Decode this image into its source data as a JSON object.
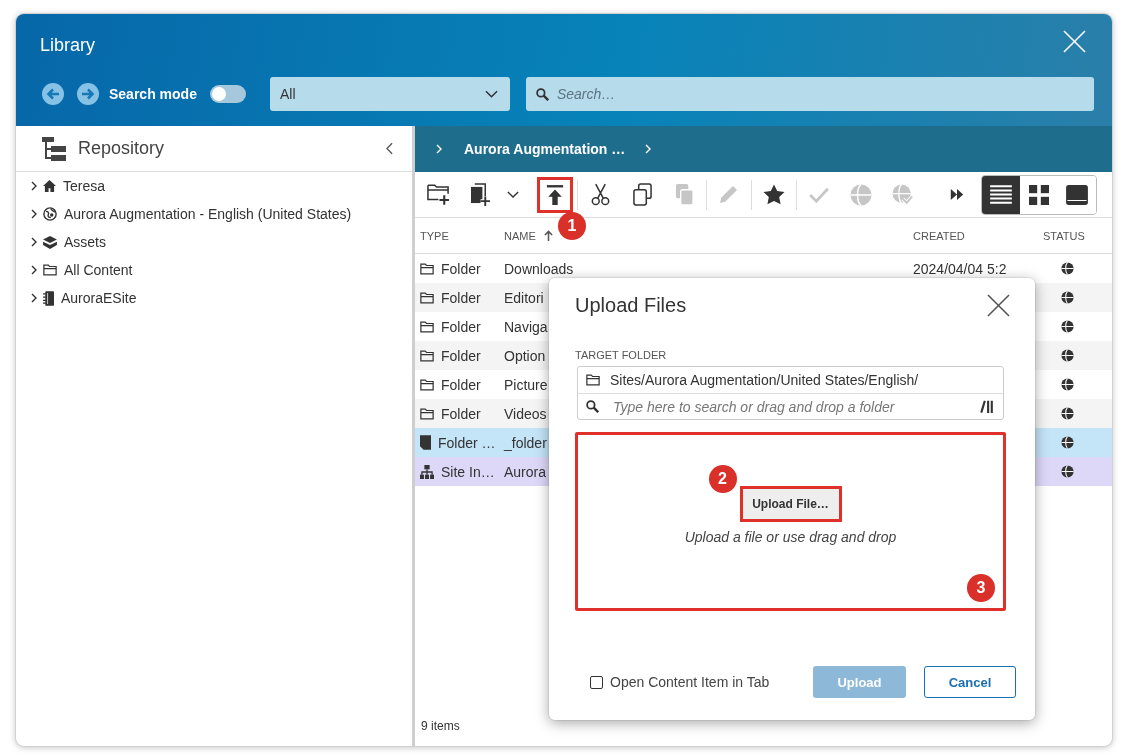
{
  "window": {
    "title": "Library"
  },
  "header": {
    "search_mode": {
      "label": "Search mode",
      "on": false
    },
    "filter": {
      "value": "All"
    },
    "search": {
      "placeholder": "Search…"
    }
  },
  "sidebar": {
    "title": "Repository",
    "items": [
      {
        "label": "Teresa",
        "expanded": false
      },
      {
        "label": "Aurora Augmentation - English (United States)",
        "expanded": false
      },
      {
        "label": "Assets",
        "expanded": false
      },
      {
        "label": "All Content",
        "expanded": false
      },
      {
        "label": "AuroraESite",
        "expanded": false
      }
    ]
  },
  "breadcrumb": {
    "items": [
      {
        "label": "Aurora Augmentation …"
      }
    ]
  },
  "toolbar": {
    "groups": [
      [
        {
          "disabled": false,
          "highlighted": false
        },
        {
          "disabled": false,
          "highlighted": false
        },
        {
          "disabled": false,
          "highlighted": false
        },
        {
          "disabled": false,
          "highlighted": true,
          "callout": "1"
        }
      ],
      [
        {
          "disabled": false,
          "highlighted": false
        },
        {
          "disabled": false,
          "highlighted": false
        },
        {
          "disabled": true,
          "highlighted": false
        }
      ],
      [
        {
          "disabled": true,
          "highlighted": false
        }
      ],
      [
        {
          "disabled": false,
          "highlighted": false
        }
      ],
      [
        {
          "disabled": true,
          "highlighted": false
        },
        {
          "disabled": true,
          "highlighted": false
        },
        {
          "disabled": true,
          "highlighted": false
        },
        {
          "disabled": false,
          "highlighted": false
        }
      ]
    ],
    "views": [
      {
        "selected": true
      },
      {
        "selected": false
      },
      {
        "selected": false
      }
    ]
  },
  "table": {
    "columns": [
      {
        "label": "TYPE",
        "sorted": false
      },
      {
        "label": "NAME",
        "sorted": true
      },
      {
        "label": "CREATED",
        "sorted": false
      },
      {
        "label": "STATUS",
        "sorted": false
      }
    ],
    "rows": [
      {
        "kind": "folder",
        "type": "Folder",
        "name": "Downloads",
        "created": "2024/04/04 5:2",
        "selected": false,
        "hovered": false
      },
      {
        "kind": "folder",
        "type": "Folder",
        "name": "Editori",
        "selected": false,
        "hovered": false
      },
      {
        "kind": "folder",
        "type": "Folder",
        "name": "Naviga",
        "selected": false,
        "hovered": false
      },
      {
        "kind": "folder",
        "type": "Folder",
        "name": "Option",
        "selected": false,
        "hovered": false
      },
      {
        "kind": "folder",
        "type": "Folder",
        "name": "Picture",
        "selected": false,
        "hovered": false
      },
      {
        "kind": "folder",
        "type": "Folder",
        "name": "Videos",
        "selected": false,
        "hovered": false
      },
      {
        "kind": "document",
        "type": "Folder …",
        "name": "_folder",
        "selected": true,
        "hovered": false
      },
      {
        "kind": "site",
        "type": "Site In…",
        "name": "Aurora",
        "selected": false,
        "hovered": true
      }
    ]
  },
  "status_bar": {
    "text": "9 items"
  },
  "dialog": {
    "title": "Upload Files",
    "target_folder": {
      "label": "TARGET FOLDER",
      "value": "Sites/Aurora Augmentation/United States/English/",
      "placeholder": "Type here to search or drag and drop a folder"
    },
    "drop_zone": {
      "highlighted": true,
      "callout": "3",
      "button": {
        "label": "Upload File…",
        "highlighted": true,
        "callout": "2"
      },
      "hint": "Upload a file or use drag and drop"
    },
    "open_in_tab": {
      "label": "Open Content Item in Tab",
      "checked": false
    },
    "buttons": [
      {
        "label": "Upload",
        "kind": "primary",
        "disabled": true
      },
      {
        "label": "Cancel",
        "kind": "secondary",
        "disabled": false
      }
    ]
  }
}
